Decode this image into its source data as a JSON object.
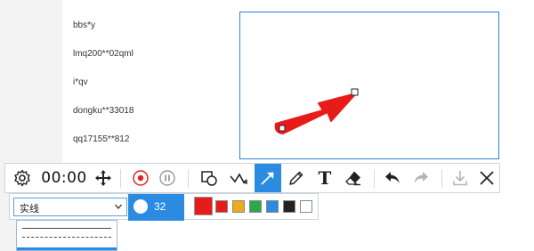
{
  "users": [
    "bbs*y",
    "lmq200**02qml",
    "i*qv",
    "dongku**33018",
    "qq17155**812"
  ],
  "timer": "00:00",
  "line_style": {
    "selected": "实线"
  },
  "brush": {
    "size": "32"
  },
  "colors": {
    "current": "#e81b1b",
    "palette": [
      "#e81b1b",
      "#f2a81d",
      "#2aa84a",
      "#2a8be0",
      "#222222",
      "#ffffff"
    ]
  },
  "toolbar_icons": [
    "gear-icon",
    "move-icon",
    "record-icon",
    "pause-icon",
    "shape-icon",
    "polyline-icon",
    "arrow-icon",
    "pencil-icon",
    "text-icon",
    "eraser-icon",
    "undo-icon",
    "redo-icon",
    "download-icon",
    "close-icon"
  ],
  "annotation": {
    "color": "#e81b1b"
  }
}
